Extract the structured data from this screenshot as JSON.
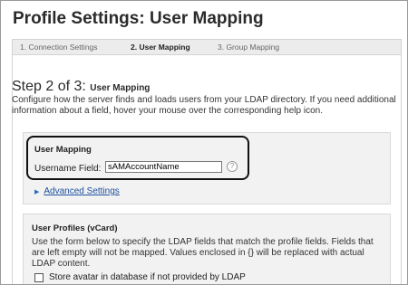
{
  "page": {
    "title": "Profile Settings: User Mapping"
  },
  "steps": [
    {
      "label": "1. Connection Settings"
    },
    {
      "label": "2. User Mapping"
    },
    {
      "label": "3. Group Mapping"
    }
  ],
  "step_heading": {
    "main": "Step 2 of 3:",
    "sub": "User Mapping"
  },
  "description": "Configure how the server finds and loads users from your LDAP directory. If you need additional information about a field, hover your mouse over the corresponding help icon.",
  "user_mapping": {
    "title": "User Mapping",
    "username_label": "Username Field:",
    "username_value": "sAMAccountName",
    "help_glyph": "?",
    "help_icon": "help-icon"
  },
  "advanced": {
    "label": "Advanced Settings",
    "icon": "triangle-right-icon"
  },
  "profiles": {
    "title": "User Profiles (vCard)",
    "description": "Use the form below to specify the LDAP fields that match the profile fields. Fields that are left empty will not be mapped. Values enclosed in {} will be replaced with actual LDAP content.",
    "checkbox_label": "Store avatar in database if not provided by LDAP"
  }
}
